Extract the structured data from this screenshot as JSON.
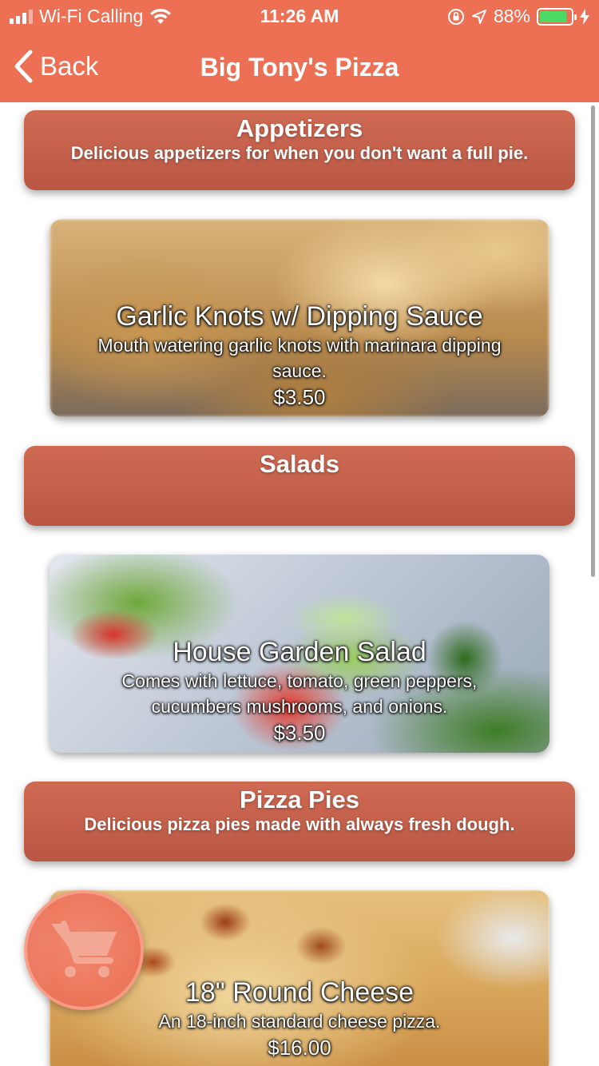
{
  "status_bar": {
    "carrier": "Wi-Fi Calling",
    "time": "11:26 AM",
    "battery": "88%",
    "battery_level": 0.88
  },
  "nav": {
    "back_label": "Back",
    "title": "Big Tony's Pizza"
  },
  "menu": {
    "categories": [
      {
        "title": "Appetizers",
        "description": "Delicious appetizers for when you don't want a full pie."
      },
      {
        "title": "Salads",
        "description": ""
      },
      {
        "title": "Pizza Pies",
        "description": "Delicious pizza pies made with always fresh dough."
      }
    ],
    "items": [
      {
        "name": "Garlic Knots w/ Dipping Sauce",
        "description": "Mouth watering garlic knots with marinara dipping sauce.",
        "price": "$3.50"
      },
      {
        "name": "House Garden Salad",
        "description": "Comes with lettuce, tomato, green peppers, cucumbers mushrooms, and onions.",
        "price": "$3.50"
      },
      {
        "name": "18\" Round Cheese",
        "description": "An 18-inch standard cheese pizza.",
        "price": "$16.00"
      }
    ]
  },
  "colors": {
    "accent": "#EE7054",
    "category_bg": "#C4604B",
    "battery_fill": "#4CD964"
  }
}
